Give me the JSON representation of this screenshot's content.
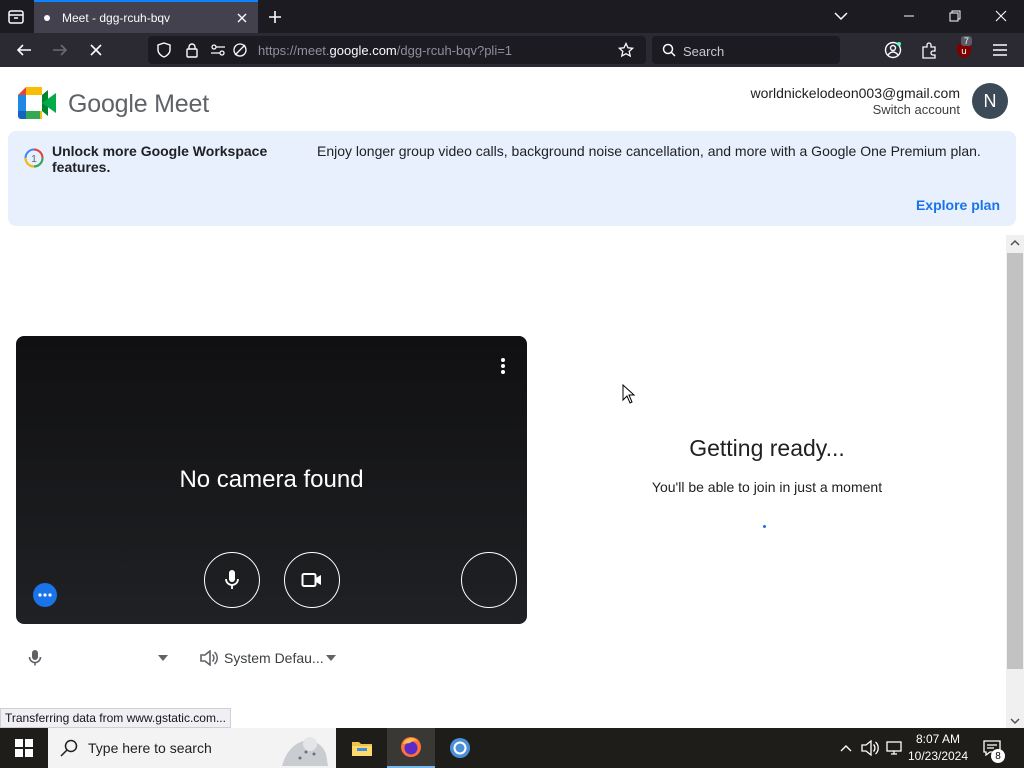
{
  "browser": {
    "tab_title": "Meet - dgg-rcuh-bqv",
    "url_prefix": "https://meet.",
    "url_domain": "google.com",
    "url_path": "/dgg-rcuh-bqv?pli=1",
    "search_placeholder": "Search",
    "extension_badge": "7"
  },
  "header": {
    "logo_text": "Google Meet",
    "account_email": "worldnickelodeon003@gmail.com",
    "switch_account": "Switch account",
    "avatar_initial": "N"
  },
  "promo": {
    "title": "Unlock more Google Workspace features.",
    "description": "Enjoy longer group video calls, background noise cancellation, and more with a Google One Premium plan.",
    "link": "Explore plan"
  },
  "preview": {
    "message": "No camera found"
  },
  "devices": {
    "microphone": "",
    "speaker": "System Defau..."
  },
  "ready": {
    "title": "Getting ready...",
    "subtitle": "You'll be able to join in just a moment"
  },
  "status_bar": "Transferring data from www.gstatic.com...",
  "taskbar": {
    "search_placeholder": "Type here to search",
    "time": "8:07 AM",
    "date": "10/23/2024",
    "notifications": "8"
  },
  "colors": {
    "accent": "#1a73e8",
    "promo_bg": "#e8f0fe",
    "tab_indicator": "#0a84ff"
  }
}
